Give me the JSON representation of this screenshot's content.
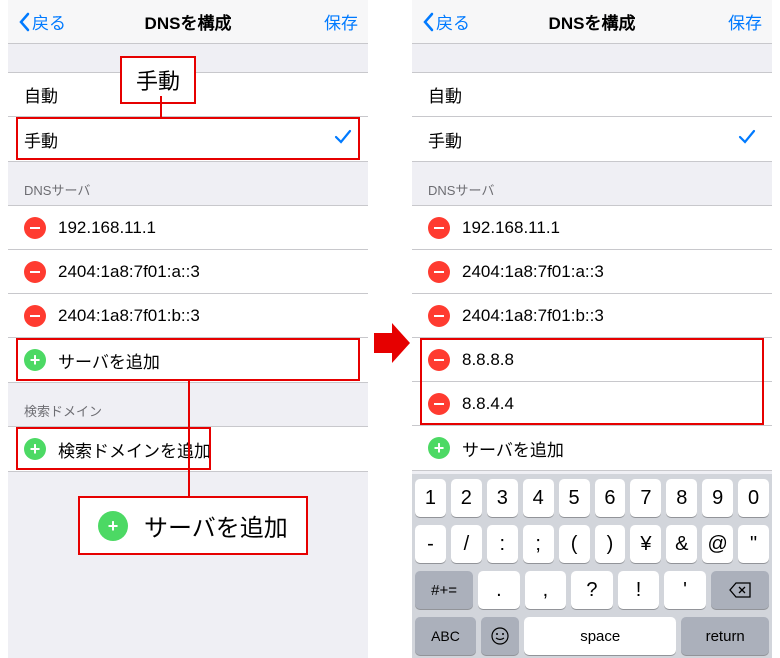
{
  "nav": {
    "back": "戻る",
    "title": "DNSを構成",
    "save": "保存"
  },
  "mode": {
    "auto": "自動",
    "manual": "手動"
  },
  "dns_section_header": "DNSサーバ",
  "left": {
    "servers": [
      "192.168.11.1",
      "2404:1a8:7f01:a::3",
      "2404:1a8:7f01:b::3"
    ],
    "add_server": "サーバを追加",
    "search_header": "検索ドメイン",
    "add_search": "検索ドメインを追加"
  },
  "right": {
    "servers": [
      "192.168.11.1",
      "2404:1a8:7f01:a::3",
      "2404:1a8:7f01:b::3",
      "8.8.8.8",
      "8.8.4.4"
    ],
    "add_server": "サーバを追加"
  },
  "callout": {
    "manual": "手動",
    "add_server": "サーバを追加"
  },
  "keyboard": {
    "row1": [
      "1",
      "2",
      "3",
      "4",
      "5",
      "6",
      "7",
      "8",
      "9",
      "0"
    ],
    "row2": [
      "-",
      "/",
      ":",
      ";",
      "(",
      ")",
      "¥",
      "&",
      "@",
      "\""
    ],
    "row3_shift": "#+=",
    "row3": [
      ".",
      ",",
      "?",
      "!",
      "'"
    ],
    "abc": "ABC",
    "space": "space",
    "return": "return"
  }
}
